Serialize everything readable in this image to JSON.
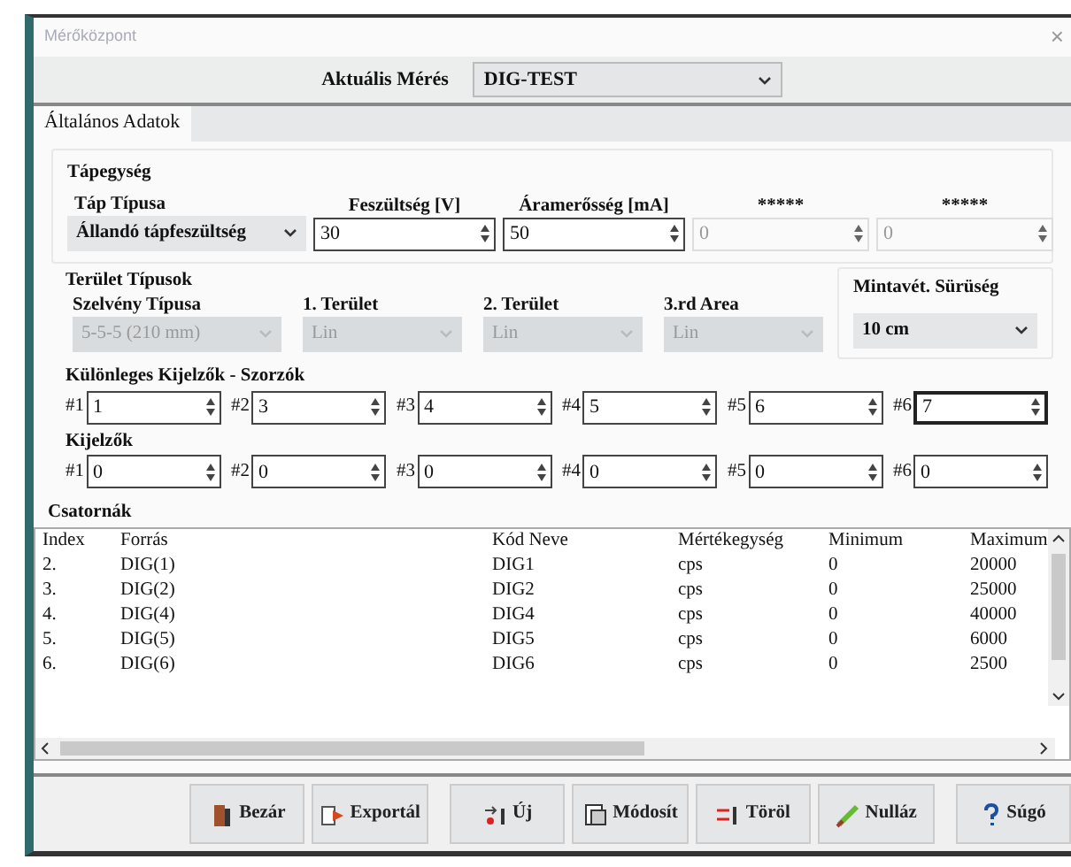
{
  "window": {
    "title": "Mérőközpont",
    "close": "×"
  },
  "current": {
    "label": "Aktuális Mérés",
    "value": "DIG-TEST"
  },
  "tabs": [
    {
      "label": "Általános Adatok",
      "selected": true
    }
  ],
  "power": {
    "title": "Tápegység",
    "type": {
      "label": "Táp Típusa",
      "value": "Állandó tápfeszültség"
    },
    "fields": [
      {
        "label": "Feszültség [V]",
        "value": "30",
        "disabled": false
      },
      {
        "label": "Áramerősség [mA]",
        "value": "50",
        "disabled": false
      },
      {
        "label": "*****",
        "value": "0",
        "disabled": true
      },
      {
        "label": "*****",
        "value": "0",
        "disabled": true
      }
    ]
  },
  "areas": {
    "title": "Terület Típusok",
    "fields": [
      {
        "label": "Szelvény Típusa",
        "value": "5-5-5  (210 mm)",
        "disabled": true
      },
      {
        "label": "1. Terület",
        "value": "Lin",
        "disabled": true
      },
      {
        "label": "2. Terület",
        "value": "Lin",
        "disabled": true
      },
      {
        "label": "3.rd Area",
        "value": "Lin",
        "disabled": true
      }
    ]
  },
  "density": {
    "label": "Mintavét. Sürüség",
    "value": "10 cm"
  },
  "multipliers": {
    "title": "Különleges Kijelzők - Szorzók",
    "fields": [
      {
        "label": "#1",
        "value": "1",
        "focused": false
      },
      {
        "label": "#2",
        "value": "3",
        "focused": false
      },
      {
        "label": "#3",
        "value": "4",
        "focused": false
      },
      {
        "label": "#4",
        "value": "5",
        "focused": false
      },
      {
        "label": "#5",
        "value": "6",
        "focused": false
      },
      {
        "label": "#6",
        "value": "7",
        "focused": true
      }
    ]
  },
  "displays": {
    "title": "Kijelzők",
    "fields": [
      {
        "label": "#1",
        "value": "0",
        "focused": false
      },
      {
        "label": "#2",
        "value": "0",
        "focused": false
      },
      {
        "label": "#3",
        "value": "0",
        "focused": false
      },
      {
        "label": "#4",
        "value": "0",
        "focused": false
      },
      {
        "label": "#5",
        "value": "0",
        "focused": false
      },
      {
        "label": "#6",
        "value": "0",
        "focused": false
      }
    ]
  },
  "channels": {
    "title": "Csatornák",
    "columns": [
      "Index",
      "Forrás",
      "Kód Neve",
      "Mértékegység",
      "Minimum",
      "Maximum"
    ],
    "rows": [
      [
        "2.",
        "DIG(1)",
        "DIG1",
        "cps",
        "0",
        "20000"
      ],
      [
        "3.",
        "DIG(2)",
        "DIG2",
        "cps",
        "0",
        "25000"
      ],
      [
        "4.",
        "DIG(4)",
        "DIG4",
        "cps",
        "0",
        "40000"
      ],
      [
        "5.",
        "DIG(5)",
        "DIG5",
        "cps",
        "0",
        "6000"
      ],
      [
        "6.",
        "DIG(6)",
        "DIG6",
        "cps",
        "0",
        "2500"
      ]
    ]
  },
  "buttons": [
    {
      "label": "Bezár"
    },
    {
      "label": "Exportál"
    },
    {
      "label": "Új"
    },
    {
      "label": "Módosít"
    },
    {
      "label": "Töröl"
    },
    {
      "label": "Nulláz"
    },
    {
      "label": "Súgó"
    }
  ]
}
